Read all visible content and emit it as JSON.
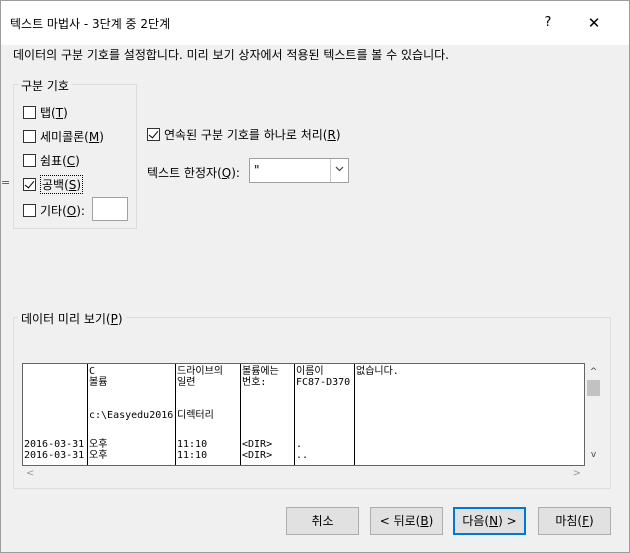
{
  "window": {
    "title": "텍스트 마법사 - 3단계 중 2단계",
    "help_label": "?",
    "close_label": "✕"
  },
  "instructions": "데이터의 구분 기호를 설정합니다. 미리 보기 상자에서 적용된 텍스트를 볼 수 있습니다.",
  "delimiters": {
    "legend": "구분 기호",
    "items": [
      {
        "label": "탭",
        "key": "T",
        "checked": false
      },
      {
        "label": "세미콜론",
        "key": "M",
        "checked": false
      },
      {
        "label": "쉼표",
        "key": "C",
        "checked": false
      },
      {
        "label": "공백",
        "key": "S",
        "checked": true
      },
      {
        "label": "기타",
        "key": "O",
        "checked": false,
        "suffix": ":"
      }
    ],
    "other_value": ""
  },
  "consecutive": {
    "label": "연속된 구분 기호를 하나로 처리",
    "key": "R",
    "checked": true
  },
  "qualifier": {
    "label": "텍스트 한정자",
    "key": "Q",
    "suffix": ":",
    "value": "\""
  },
  "side_marker": "=",
  "preview": {
    "legend": "데이터 미리 보기",
    "key": "P",
    "columns": [
      [
        "",
        "",
        "",
        "",
        "",
        "2016-03-31",
        "2016-03-31"
      ],
      [
        "C",
        "볼륨",
        "",
        "c:\\Easyedu2016",
        "",
        "오후",
        "오후"
      ],
      [
        "드라이브의",
        "일련",
        "",
        "디렉터리",
        "",
        "11:10",
        "11:10"
      ],
      [
        "볼륨에는",
        "번호:",
        "",
        "",
        "",
        "<DIR>",
        "<DIR>"
      ],
      [
        "이름이",
        "FC87-D370",
        "",
        "",
        "",
        ".",
        ".."
      ],
      [
        "없습니다.",
        "",
        "",
        "",
        "",
        "",
        ""
      ]
    ],
    "scroll_up": "^",
    "scroll_down": "v",
    "scroll_left": "<",
    "scroll_right": ">"
  },
  "buttons": {
    "cancel": "취소",
    "back": {
      "prefix": "< 뒤로(",
      "key": "B",
      "suffix": ")"
    },
    "next": {
      "prefix": "다음(",
      "key": "N",
      "suffix": ") >"
    },
    "finish": {
      "prefix": "마침(",
      "key": "F",
      "suffix": ")"
    }
  }
}
